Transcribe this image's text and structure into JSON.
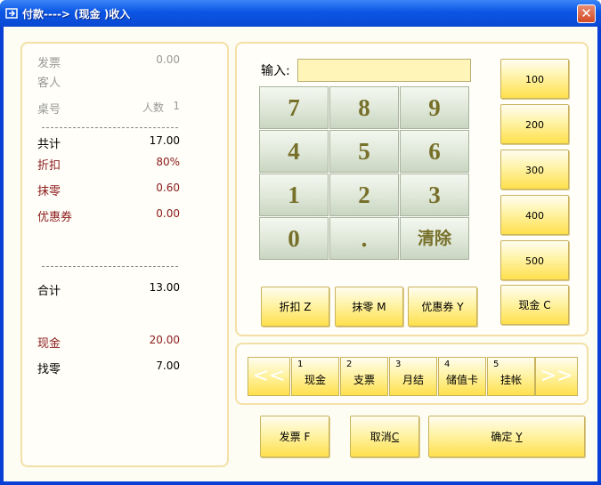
{
  "window": {
    "title": "付款----> (现金 )收入",
    "close_glyph": "✕"
  },
  "summary": {
    "invoice": {
      "label": "发票",
      "value": "0.00"
    },
    "guest": {
      "label": "客人"
    },
    "table": {
      "label": "桌号",
      "people_label": "人数",
      "people_value": "1"
    },
    "total": {
      "label": "共计",
      "value": "17.00"
    },
    "discount": {
      "label": "折扣",
      "value": "80%"
    },
    "rounding": {
      "label": "抹零",
      "value": "0.60"
    },
    "coupon": {
      "label": "优惠券",
      "value": "0.00"
    },
    "subtotal": {
      "label": "合计",
      "value": "13.00"
    },
    "cash": {
      "label": "现金",
      "value": "20.00"
    },
    "change": {
      "label": "找零",
      "value": "7.00"
    }
  },
  "keypad": {
    "input_label": "输入:",
    "input_value": "",
    "keys": [
      "7",
      "8",
      "9",
      "4",
      "5",
      "6",
      "1",
      "2",
      "3",
      "0",
      ".",
      "清除"
    ],
    "amount_buttons": [
      "100",
      "200",
      "300",
      "400",
      "500"
    ],
    "discount_button": "折扣 Z",
    "rounding_button": "抹零 M",
    "coupon_button": "优惠券 Y",
    "cash_button": "现金 C"
  },
  "payment_types": {
    "prev_glyph": "<<",
    "next_glyph": ">>",
    "items": [
      {
        "num": "1",
        "name": "现金"
      },
      {
        "num": "2",
        "name": "支票"
      },
      {
        "num": "3",
        "name": "月结"
      },
      {
        "num": "4",
        "name": "储值卡"
      },
      {
        "num": "5",
        "name": "挂帐"
      }
    ]
  },
  "actions": {
    "invoice": {
      "text": "发票 F"
    },
    "cancel": {
      "text": "取消",
      "key": "C"
    },
    "confirm": {
      "text": "确定 ",
      "key": "Y"
    }
  },
  "colors": {
    "title_bar": "#0b56e4",
    "key_text": "#77702a",
    "highlight_red": "#8a1a1a",
    "button_yellow": "#ffe04d"
  }
}
